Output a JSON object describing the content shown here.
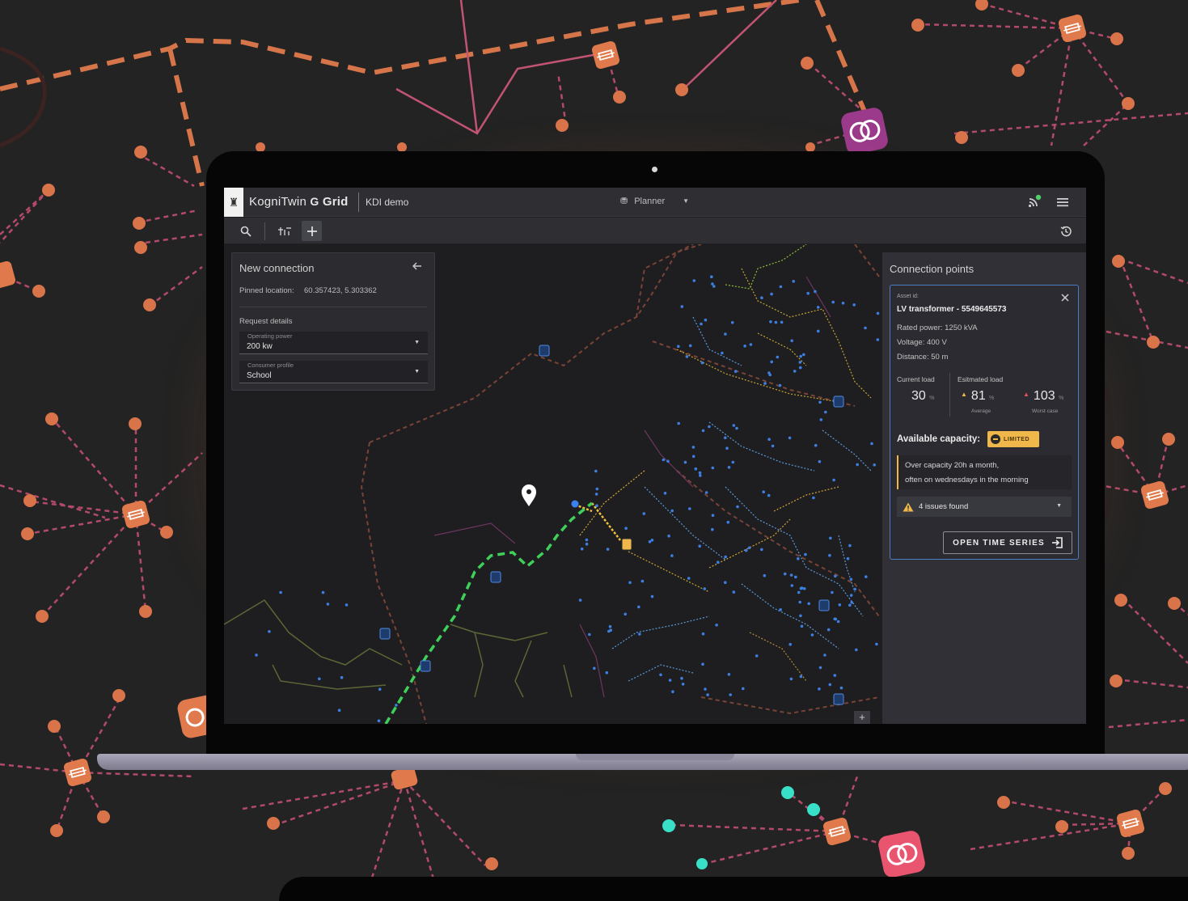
{
  "app": {
    "brand_prefix": "KogniTwin",
    "brand_suffix": "Grid",
    "project": "KDI demo",
    "mode": "Planner"
  },
  "new_connection": {
    "title": "New connection",
    "pinned_label": "Pinned location:",
    "pinned_value": "60.357423, 5.303362",
    "request_details": "Request details",
    "operating_power_label": "Operating power",
    "operating_power_value": "200 kw",
    "consumer_profile_label": "Consumer profile",
    "consumer_profile_value": "School"
  },
  "connection_points": {
    "title": "Connection points",
    "asset_id_label": "Asset id:",
    "asset_name": "LV transformer - 5549645573",
    "rated_power": "Rated power: 1250 kVA",
    "voltage": "Voltage:  400 V",
    "distance": "Distance: 50 m",
    "current_load_label": "Current load",
    "estimated_load_label": "Esitmated load",
    "current_load_value": "30",
    "average_value": "81",
    "worst_value": "103",
    "percent_unit": "%",
    "average_label": "Average",
    "worst_label": "Worst case",
    "available_capacity_label": "Available capacity:",
    "capacity_status": "LIMITED",
    "note_line1": "Over capacity 20h a month,",
    "note_line2": "often on wednesdays in the morning",
    "issues": "4 issues found",
    "open_button": "OPEN TIME SERIES"
  },
  "colors": {
    "accent_blue": "#4b7cc6",
    "warning_yellow": "#f0b84a",
    "route_green": "#3fd05a",
    "grid_orange": "#d9734a",
    "grid_pink": "#c45a78"
  },
  "icons": [
    "search-icon",
    "filter-icon",
    "plus-icon",
    "history-icon",
    "rss-icon",
    "menu-icon",
    "back-arrow-icon",
    "close-icon",
    "warning-icon",
    "export-icon",
    "location-pin-icon",
    "planner-icon"
  ]
}
